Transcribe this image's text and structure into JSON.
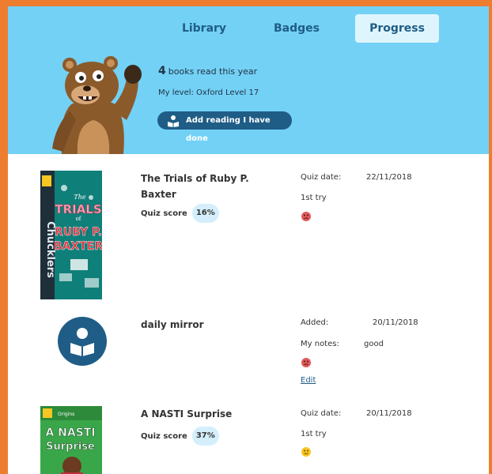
{
  "tabs": [
    {
      "label": "Library"
    },
    {
      "label": "Badges"
    },
    {
      "label": "Progress"
    }
  ],
  "header": {
    "books_count": "4",
    "books_suffix": "books read this year",
    "level": "My level: Oxford Level 17",
    "add_button": "Add reading I have done"
  },
  "entries": [
    {
      "title": "The Trials of Ruby P. Baxter",
      "score_label": "Quiz score",
      "score": "16%",
      "date_label": "Quiz date:",
      "date": "22/11/2018",
      "try": "1st try",
      "cover_text": {
        "top": "The",
        "line1": "TRIALS",
        "line2": "of",
        "line3": "RUBY P.",
        "line4": "BAXTER",
        "series": "Chucklers"
      }
    },
    {
      "title": "daily mirror",
      "added_label": "Added:",
      "added": "20/11/2018",
      "notes_label": "My notes:",
      "notes": "good",
      "edit": "Edit"
    },
    {
      "title": "A NASTI Surprise",
      "score_label": "Quiz score",
      "score": "37%",
      "date_label": "Quiz date:",
      "date": "20/11/2018",
      "try": "1st try",
      "cover_text": {
        "series": "Origins",
        "line1": "A NASTI",
        "line2": "Surprise"
      }
    }
  ],
  "colors": {
    "frame": "#ee7d30",
    "header_bg": "#73d1f6",
    "accent": "#1f5d86",
    "pill": "#d4effb",
    "sad_face": "#e05a5a",
    "neutral_face": "#f6c623"
  }
}
